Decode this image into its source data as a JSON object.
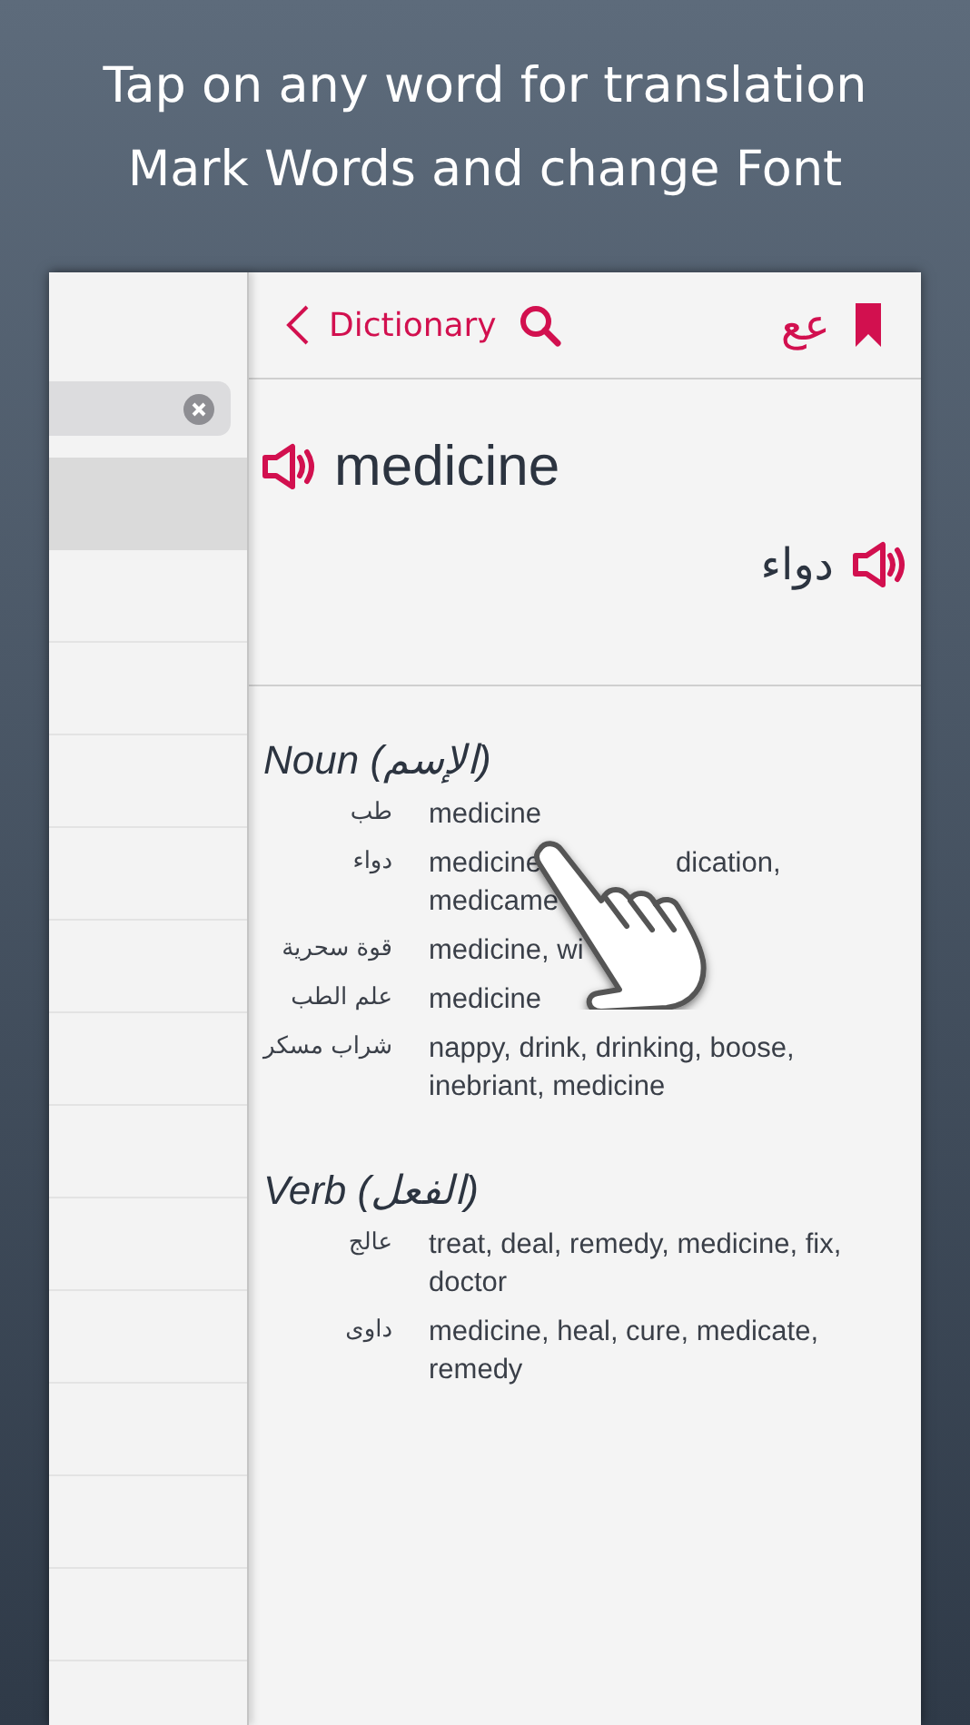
{
  "headline": [
    "Tap on any word for translation",
    "Mark Words and change Font"
  ],
  "list": {
    "rows": [
      {
        "selected": true
      },
      {
        "selected": false
      },
      {
        "selected": false
      },
      {
        "selected": false
      },
      {
        "selected": false
      },
      {
        "selected": false
      },
      {
        "selected": false
      },
      {
        "selected": false
      },
      {
        "selected": false
      },
      {
        "selected": false
      },
      {
        "selected": false
      },
      {
        "selected": false
      },
      {
        "selected": false
      }
    ]
  },
  "nav": {
    "back_label": "Dictionary",
    "font_toggle": "عع"
  },
  "entry": {
    "word": "medicine",
    "translation": "دواء"
  },
  "sections": [
    {
      "title": "Noun",
      "title_arabic": "(الإسم)",
      "rows": [
        {
          "arabic": "طب",
          "lines": [
            {
              "text": "medicine"
            }
          ]
        },
        {
          "arabic": "دواء",
          "lines": [
            {
              "text": "medicine",
              "text_after_hand": "dication,"
            },
            {
              "text": "medicame"
            }
          ]
        },
        {
          "arabic": "قوة سحرية",
          "lines": [
            {
              "text": "medicine, wi"
            }
          ]
        },
        {
          "arabic": "علم الطب",
          "lines": [
            {
              "text": "medicine"
            }
          ]
        },
        {
          "arabic": "شراب مسكر",
          "lines": [
            {
              "text": "nappy, drink, drinking, boose,"
            },
            {
              "text": "inebriant, medicine"
            }
          ]
        }
      ]
    },
    {
      "title": "Verb",
      "title_arabic": "(الفعل)",
      "rows": [
        {
          "arabic": "عالج",
          "lines": [
            {
              "text": "treat, deal, remedy, medicine, fix,"
            },
            {
              "text": "doctor"
            }
          ]
        },
        {
          "arabic": "داوى",
          "lines": [
            {
              "text": "medicine, heal, cure, medicate,"
            },
            {
              "text": "remedy"
            }
          ]
        }
      ]
    }
  ]
}
